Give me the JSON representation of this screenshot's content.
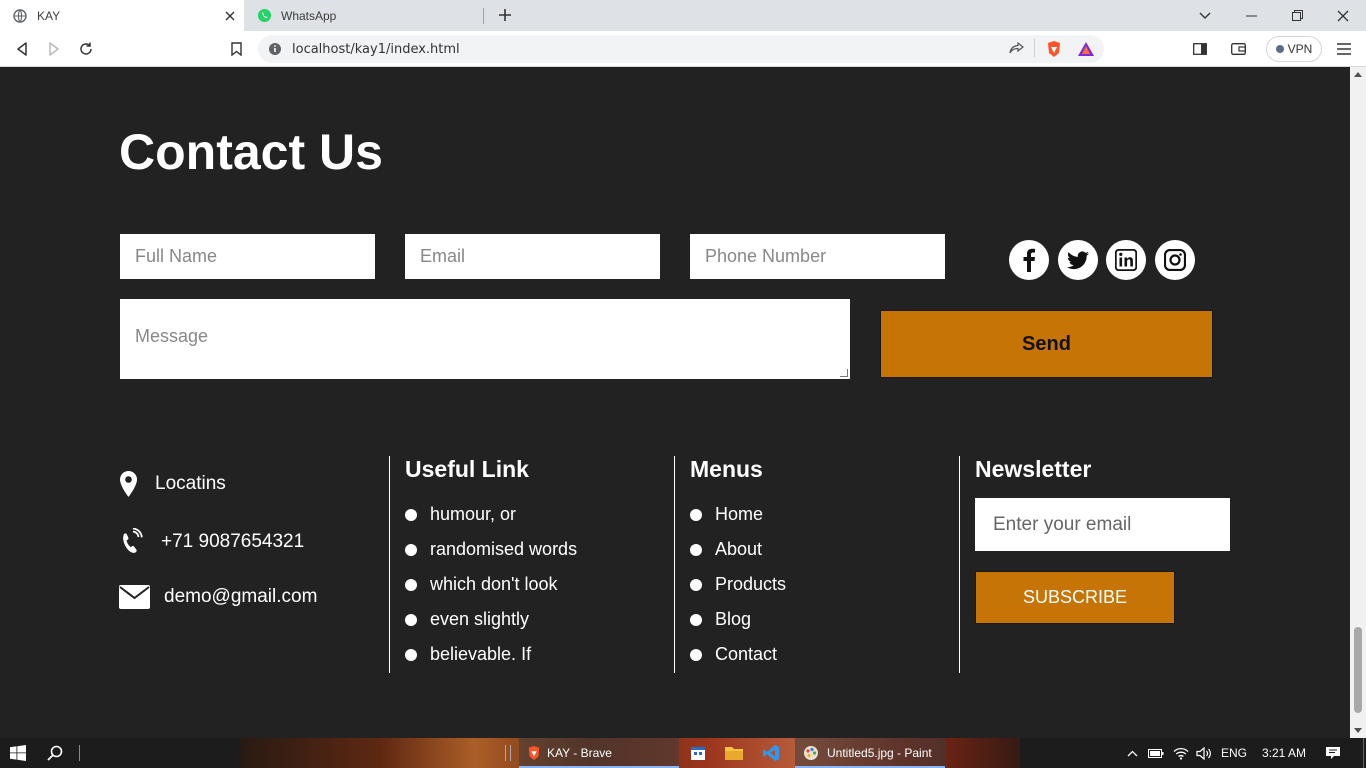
{
  "browser": {
    "tabs": [
      {
        "title": "KAY",
        "active": true
      },
      {
        "title": "WhatsApp",
        "active": false
      }
    ],
    "url": "localhost/kay1/index.html",
    "vpn_label": "VPN"
  },
  "contact": {
    "title": "Contact Us",
    "full_name_placeholder": "Full Name",
    "email_placeholder": "Email",
    "phone_placeholder": "Phone Number",
    "message_placeholder": "Message",
    "send_label": "Send",
    "social": [
      "facebook-icon",
      "twitter-icon",
      "linkedin-icon",
      "instagram-icon"
    ]
  },
  "footer": {
    "location": "Locatins",
    "phone": "+71 9087654321",
    "email": "demo@gmail.com",
    "useful_links": {
      "title": "Useful Link",
      "items": [
        "humour, or",
        "randomised words",
        "which don't look",
        "even slightly",
        "believable. If"
      ]
    },
    "menus": {
      "title": "Menus",
      "items": [
        "Home",
        "About",
        "Products",
        "Blog",
        "Contact"
      ]
    },
    "newsletter": {
      "title": "Newsletter",
      "email_placeholder": "Enter your email",
      "subscribe_label": "SUBSCRIBE"
    }
  },
  "taskbar": {
    "apps": [
      {
        "label": "KAY - Brave"
      },
      {
        "label": "Untitled5.jpg - Paint"
      }
    ],
    "language": "ENG",
    "time": "3:21 AM"
  },
  "colors": {
    "page_bg": "#222222",
    "accent": "#c67406"
  }
}
